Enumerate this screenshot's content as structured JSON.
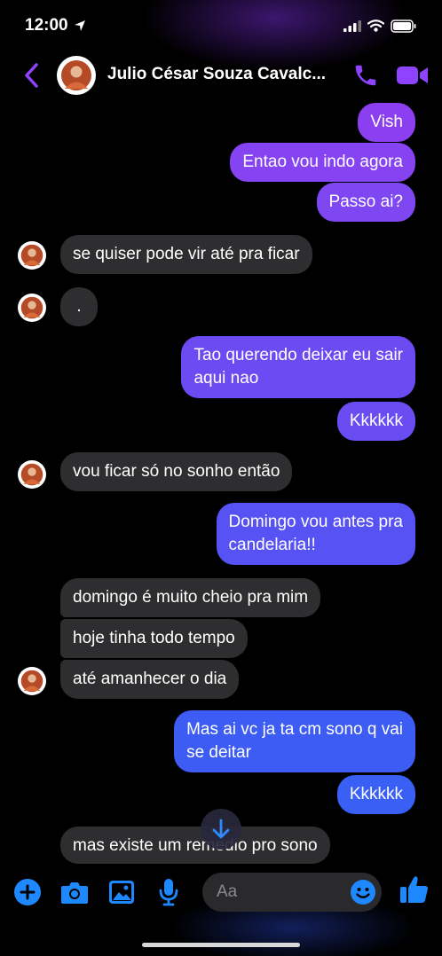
{
  "status": {
    "time": "12:00"
  },
  "header": {
    "contact_name": "Julio César Souza Cavalc..."
  },
  "messages": [
    {
      "text": "Vish"
    },
    {
      "text": "Entao vou indo agora"
    },
    {
      "text": "Passo ai?"
    },
    {
      "text": "se quiser pode vir até pra ficar"
    },
    {
      "text": "."
    },
    {
      "line1": "Tao querendo deixar eu sair",
      "line2": "aqui nao"
    },
    {
      "text": "Kkkkkk"
    },
    {
      "text": "vou ficar só no sonho então"
    },
    {
      "line1": "Domingo vou antes pra",
      "line2": "candelaria!!"
    },
    {
      "text": "domingo é muito cheio pra mim"
    },
    {
      "text": "hoje tinha todo tempo"
    },
    {
      "text": "até amanhecer o dia"
    },
    {
      "line1": "Mas ai vc ja ta cm sono q vai",
      "line2": "se deitar"
    },
    {
      "text": "Kkkkkk"
    },
    {
      "text": "mas existe um remedio pro sono"
    }
  ],
  "composer": {
    "placeholder": "Aa"
  },
  "colors": {
    "accent": "#8e44ff",
    "blue": "#1e88ff",
    "incoming_bubble": "#2e2e30"
  }
}
